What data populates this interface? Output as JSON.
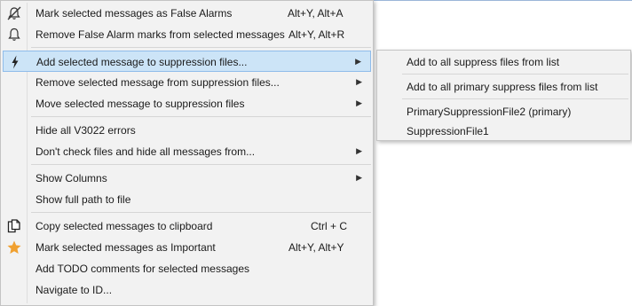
{
  "main_menu": {
    "items": [
      {
        "label": "Mark selected messages as False Alarms",
        "shortcut": "Alt+Y, Alt+A",
        "icon": "false-alarm-icon"
      },
      {
        "label": "Remove False Alarm marks from selected messages",
        "shortcut": "Alt+Y, Alt+R",
        "icon": "bell-icon"
      },
      {
        "label": "Add selected message to suppression files...",
        "icon": "lightning-icon"
      },
      {
        "label": "Remove selected message from suppression files..."
      },
      {
        "label": "Move selected message to suppression files"
      },
      {
        "label": "Hide all V3022 errors"
      },
      {
        "label": "Don't check files and hide all messages from..."
      },
      {
        "label": "Show Columns"
      },
      {
        "label": "Show full path to file"
      },
      {
        "label": "Copy selected messages to clipboard",
        "shortcut": "Ctrl + C",
        "icon": "copy-icon"
      },
      {
        "label": "Mark selected messages as Important",
        "shortcut": "Alt+Y, Alt+Y",
        "icon": "star-icon"
      },
      {
        "label": "Add TODO comments for selected messages"
      },
      {
        "label": "Navigate to ID..."
      }
    ]
  },
  "sub_menu": {
    "items": [
      {
        "label": "Add to all suppress files from list"
      },
      {
        "label": "Add to all primary suppress files from list"
      },
      {
        "label": "PrimarySuppressionFile2 (primary)"
      },
      {
        "label": "SuppressionFile1"
      }
    ]
  },
  "colors": {
    "highlight": "#cce4f7",
    "star": "#f0a030",
    "menu_bg": "#f2f2f2"
  }
}
